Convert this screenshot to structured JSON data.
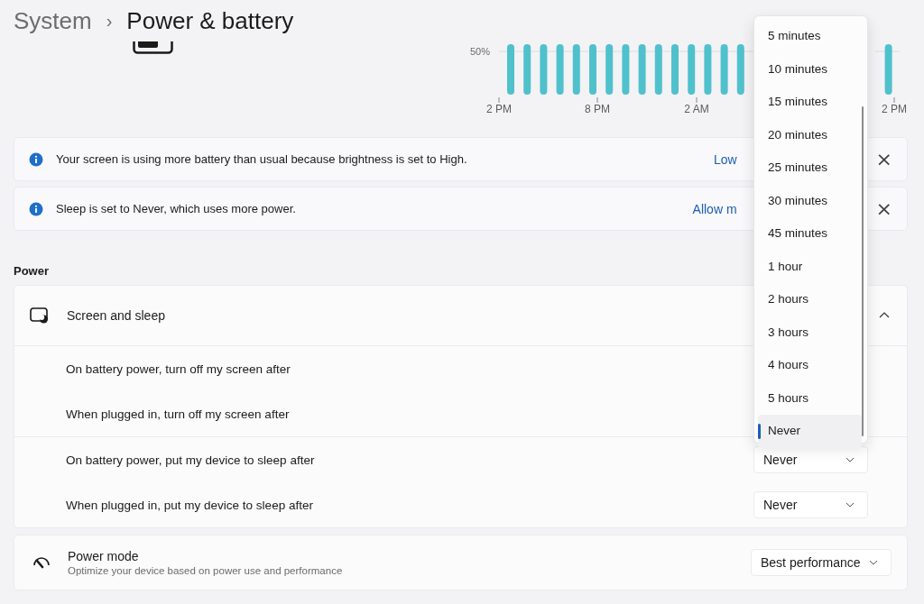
{
  "breadcrumb": {
    "parent": "System",
    "separator": "›",
    "title": "Power & battery"
  },
  "usage_chart": {
    "y_tick": "50%",
    "x_labels": [
      "2 PM",
      "8 PM",
      "2 AM",
      "2 PM"
    ]
  },
  "notices": [
    {
      "text": "Your screen is using more battery than usual because brightness is set to High.",
      "link": "Low",
      "close": "×"
    },
    {
      "text": "Sleep is set to Never, which uses more power.",
      "link": "Allow m",
      "close": "×"
    }
  ],
  "section": "Power",
  "screen_and_sleep": {
    "title": "Screen and sleep",
    "expanded": true,
    "rows": [
      {
        "label": "On battery power, turn off my screen after"
      },
      {
        "label": "When plugged in, turn off my screen after"
      },
      {
        "label": "On battery power, put my device to sleep after",
        "value": "Never"
      },
      {
        "label": "When plugged in, put my device to sleep after",
        "value": "Never"
      }
    ]
  },
  "power_mode": {
    "title": "Power mode",
    "description": "Optimize your device based on power use and performance",
    "value": "Best performance"
  },
  "menu": {
    "items": [
      {
        "label": "5 minutes",
        "selected": false
      },
      {
        "label": "10 minutes",
        "selected": false
      },
      {
        "label": "15 minutes",
        "selected": false
      },
      {
        "label": "20 minutes",
        "selected": false
      },
      {
        "label": "25 minutes",
        "selected": false
      },
      {
        "label": "30 minutes",
        "selected": false
      },
      {
        "label": "45 minutes",
        "selected": false
      },
      {
        "label": "1 hour",
        "selected": false
      },
      {
        "label": "2 hours",
        "selected": false
      },
      {
        "label": "3 hours",
        "selected": false
      },
      {
        "label": "4 hours",
        "selected": false
      },
      {
        "label": "5 hours",
        "selected": false
      },
      {
        "label": "Never",
        "selected": true
      }
    ]
  }
}
